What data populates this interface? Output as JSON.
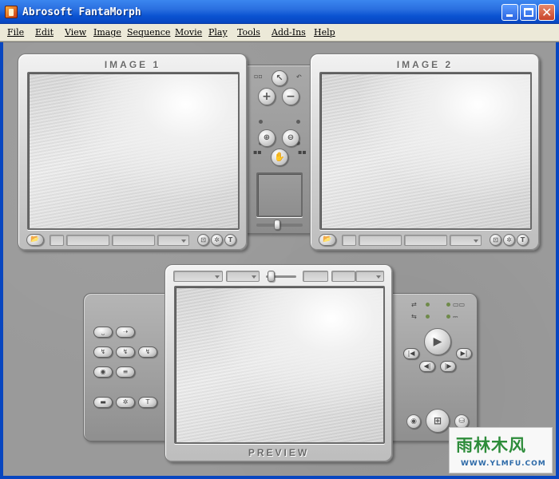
{
  "window": {
    "title": "Abrosoft FantaMorph"
  },
  "menu": [
    "File",
    "Edit",
    "View",
    "Image",
    "Sequence",
    "Movie",
    "Play",
    "Tools",
    "Add-Ins",
    "Help"
  ],
  "panels": {
    "image1": {
      "title": "IMAGE 1"
    },
    "image2": {
      "title": "IMAGE 2"
    },
    "preview": {
      "title": "PREVIEW"
    }
  },
  "watermark": {
    "line1": "雨林木风",
    "line2": "WWW.YLMFU.COM"
  },
  "colors": {
    "titlebar": "#0a52d1",
    "menubar": "#ece9d8",
    "workspace": "#9a9a9a",
    "panel": "#cfcfcf"
  }
}
